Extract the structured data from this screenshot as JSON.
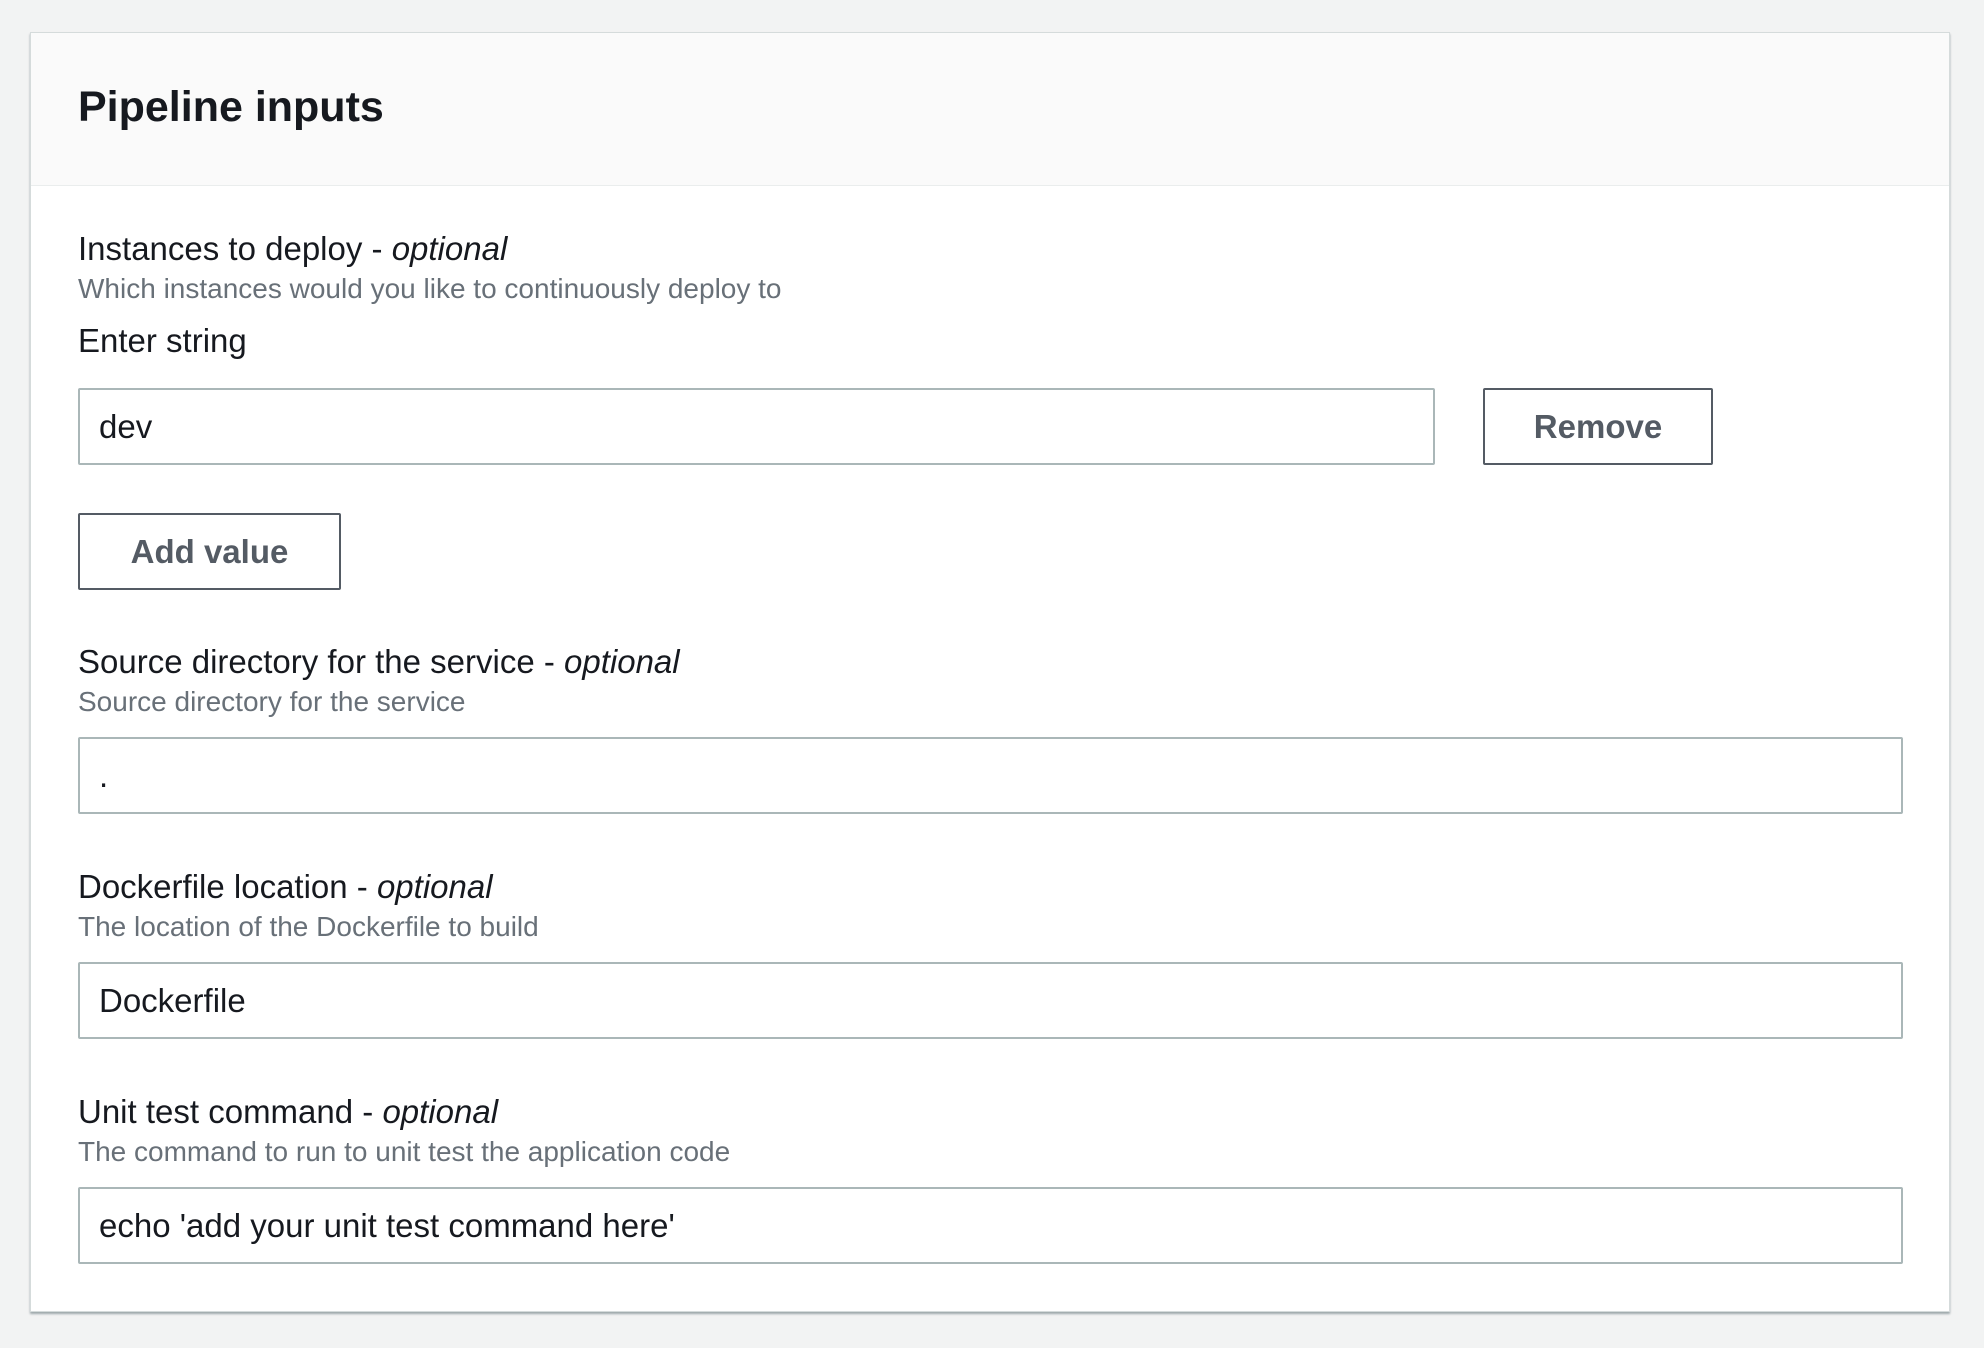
{
  "panel": {
    "title": "Pipeline inputs"
  },
  "fields": {
    "instances": {
      "label": "Instances to deploy - ",
      "optional": "optional",
      "description": "Which instances would you like to continuously deploy to",
      "sublabel": "Enter string",
      "value": "dev",
      "remove_label": "Remove",
      "add_label": "Add value"
    },
    "source_dir": {
      "label": "Source directory for the service - ",
      "optional": "optional",
      "description": "Source directory for the service",
      "value": "."
    },
    "dockerfile": {
      "label": "Dockerfile location - ",
      "optional": "optional",
      "description": "The location of the Dockerfile to build",
      "value": "Dockerfile"
    },
    "unit_test": {
      "label": "Unit test command - ",
      "optional": "optional",
      "description": "The command to run to unit test the application code",
      "value": "echo 'add your unit test command here'"
    }
  },
  "colors": {
    "page_background": "#f2f3f3",
    "header_background": "#fafafa",
    "label_text": "#16191f",
    "description_text": "#687078",
    "button_text": "#545b64",
    "input_border": "#aab7b8"
  }
}
